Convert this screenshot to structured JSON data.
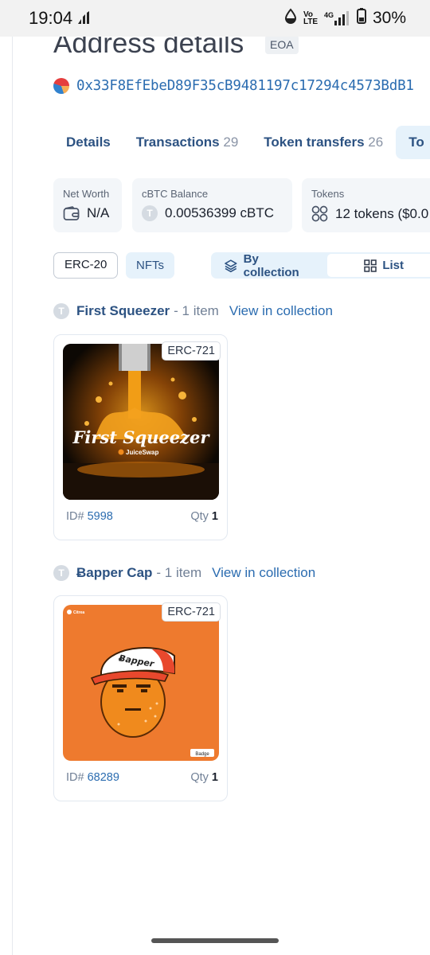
{
  "status_bar": {
    "time": "19:04",
    "network": "4G",
    "volte": "Vo LTE",
    "battery": "30%"
  },
  "page": {
    "title": "Address details",
    "badge": "EOA"
  },
  "address": {
    "hash": "0x33F8EfEbeD89F35cB9481197c17294c4573BdB1"
  },
  "tabs": [
    {
      "label": "Details",
      "count": ""
    },
    {
      "label": "Transactions",
      "count": "29"
    },
    {
      "label": "Token transfers",
      "count": "26"
    },
    {
      "label": "To",
      "count": ""
    }
  ],
  "summary": {
    "net_worth": {
      "label": "Net Worth",
      "value": "N/A"
    },
    "balance": {
      "label": "cBTC Balance",
      "value": "0.00536399 cBTC",
      "coin_letter": "T"
    },
    "tokens": {
      "label": "Tokens",
      "value": "12 tokens ($0.0"
    }
  },
  "filters": {
    "erc20": "ERC-20",
    "nfts": "NFTs"
  },
  "view_toggle": {
    "by_collection": "By collection",
    "list": "List"
  },
  "collections": [
    {
      "letter": "T",
      "name": "First Squeezer",
      "count": "- 1 item",
      "view": "View in collection",
      "nft": {
        "standard": "ERC-721",
        "id_label": "ID#",
        "id": "5998",
        "qty_label": "Qty",
        "qty": "1",
        "art_title": "First Squeezer",
        "art_brand": "JuiceSwap"
      }
    },
    {
      "letter": "T",
      "name": "Ƀapper Cap",
      "count": "- 1 item",
      "view": "View in collection",
      "nft": {
        "standard": "ERC-721",
        "id_label": "ID#",
        "id": "68289",
        "qty_label": "Qty",
        "qty": "1",
        "art_cap": "Ƀapper",
        "art_tag": "Badge",
        "art_corner": "Citrea"
      }
    }
  ],
  "colors": {
    "accent": "#2c5282",
    "link": "#2b6cb0",
    "tab_active_bg": "#e6f2fb",
    "nft2_bg": "#ee7a2e"
  }
}
